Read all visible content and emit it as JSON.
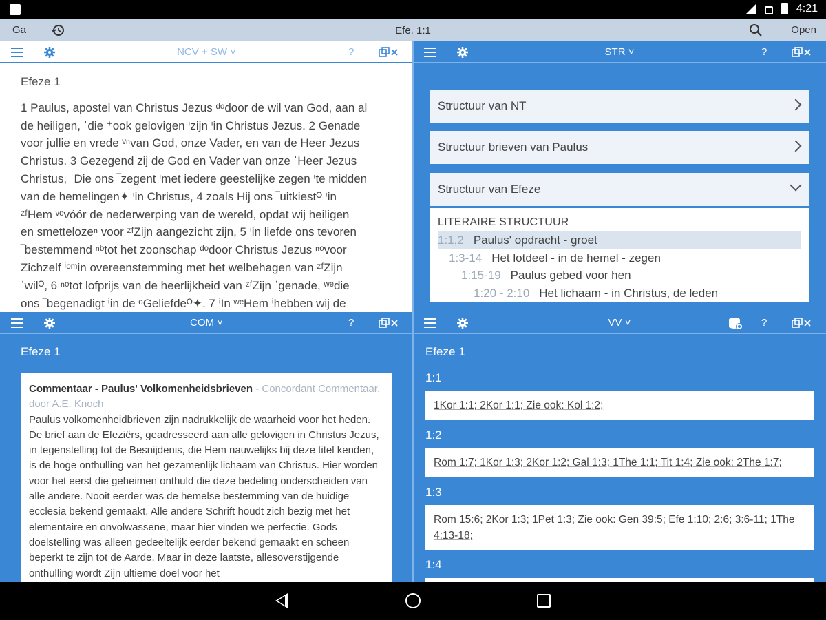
{
  "status": {
    "time": "4:21"
  },
  "topbar": {
    "go": "Ga",
    "title": "Efe. 1:1",
    "open": "Open"
  },
  "panes": {
    "p1": {
      "title": "NCV + SW ˅",
      "help": "?"
    },
    "p2": {
      "title": "STR ˅",
      "help": "?"
    },
    "p3": {
      "title": "COM ˅",
      "help": "?"
    },
    "p4": {
      "title": "VV ˅",
      "help": "?"
    }
  },
  "bible": {
    "heading": "Efeze 1",
    "lines": [
      "1 Paulus, apostel van Christus Jezus ᵈᵒdoor de wil van God, aan al",
      "de heiligen, ˈdie ⁺ook gelovigen ⁱzijn ⁱin Christus Jezus. 2 Genade",
      "voor jullie en vrede ᵛⁿvan God, onze Vader, en van de Heer Jezus",
      "Christus. 3 Gezegend zij de God en Vader van onze ˈHeer Jezus",
      "Christus, ˈDie ons ‾zegent ⁱmet iedere geestelijke zegen ⁱte midden",
      "van de hemelingen✦ ⁱin Christus, 4 zoals Hij ons ‾uitkiestᴼ ⁱin",
      "ᶻᶠHem ᵛᵒvóór de nederwerping van de wereld, opdat wij heiligen",
      "en  smettelozeⁿ voor ᶻᶠZijn aangezicht zijn, 5 ⁱin liefde ons tevoren",
      "‾bestemmend ⁿᵇtot het zoonschap ᵈᵒdoor Christus Jezus ⁿᵒvoor",
      "Zichzelf ⁱᵒᵐin overeenstemming met het welbehagen van ᶻᶠZijn",
      "ˈwilᴼ, 6 ⁿᵒtot lofprijs van de heerlijkheid van ᶻᶠZijn ˈgenade, ʷᵉdie",
      "ons ‾begenadigt ⁱin de ᵒGeliefdeᴼ✦. 7 ⁱIn ʷᵉHem ⁱhebben wij de"
    ]
  },
  "str": {
    "items": [
      "Structuur van NT",
      "Structuur brieven van Paulus",
      "Structuur van Efeze"
    ],
    "subheading": "LITERAIRE STRUCTUUR",
    "lines": [
      {
        "ref": "1:1,2",
        "text": "Paulus' opdracht - groet"
      },
      {
        "ref": "1:3-14",
        "text": "Het lotdeel - in de hemel - zegen"
      },
      {
        "ref": "1:15-19",
        "text": "Paulus gebed voor hen"
      },
      {
        "ref": "1:20 - 2:10",
        "text": "Het lichaam - in Christus, de leden"
      }
    ]
  },
  "com": {
    "heading": "Efeze 1",
    "card_title": "Commentaar - Paulus' Volkomenheidsbrieven",
    "card_source": " - Concordant Commentaar, door A.E. Knoch",
    "body": "Paulus volkomenheidbrieven zijn nadrukkelijk de waarheid voor het heden. De brief aan de Efeziërs, geadresseerd aan alle gelovigen in Christus Jezus, in tegenstelling tot de Besnijdenis, die Hem nauwelijks bij deze titel kenden, is de hoge onthulling van het gezamenlijk lichaam van Christus. Hier worden voor het eerst die geheimen onthuld die deze bedeling onderscheiden van alle andere. Nooit eerder was de hemelse bestemming van de huidige ecclesia bekend gemaakt. Alle andere Schrift houdt zich bezig met het elementaire en onvolwassene, maar hier vinden we perfectie. Gods doelstelling was alleen gedeeltelijk eerder bekend gemaakt en scheen beperkt te zijn tot de Aarde. Maar in deze laatste, allesoverstijgende onthulling wordt Zijn ultieme doel voor het"
  },
  "vv": {
    "heading": "Efeze 1",
    "verses": [
      {
        "label": "1:1",
        "refs": "1Kor 1:1; 2Kor 1:1; Zie ook: Kol 1:2;"
      },
      {
        "label": "1:2",
        "refs": "Rom 1:7; 1Kor 1:3; 2Kor 1:2; Gal 1:3; 1The 1:1; Tit 1:4; Zie ook: 2The 1:7;"
      },
      {
        "label": "1:3",
        "refs": "Rom 15:6; 2Kor 1:3; 1Pet 1:3; Zie ook: Gen 39:5; Efe 1:10; 2:6; 3:6-11; 1The 4:13-18;"
      },
      {
        "label": "1:4",
        "refs": ""
      }
    ]
  }
}
